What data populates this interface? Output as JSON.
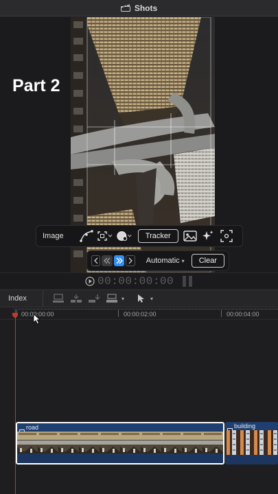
{
  "window": {
    "title": "Shots",
    "title_icon": "clapperboard-icon"
  },
  "viewer": {
    "overlay_text": "Part 2"
  },
  "inspector": {
    "label": "Image",
    "tools": [
      "bezier-pen-icon",
      "crop-select-icon",
      "color-blob-icon",
      "image-icon",
      "sparkles-icon",
      "focus-icon"
    ],
    "tracker_label": "Tracker"
  },
  "tracking": {
    "mode_label": "Automatic",
    "clear_label": "Clear"
  },
  "transport": {
    "timecode": "00:00:00:00"
  },
  "timeline_toolbar": {
    "index_label": "Index"
  },
  "timeline": {
    "ruler_labels": [
      "00:00:00:00",
      "00:00:02:00",
      "00:00:04:00"
    ],
    "clips": [
      {
        "name": "road",
        "selected": true
      },
      {
        "name": "building",
        "selected": false
      }
    ]
  },
  "colors": {
    "accent": "#2f8ff5",
    "playhead": "#c0392b",
    "clip": "#1d3a66"
  }
}
